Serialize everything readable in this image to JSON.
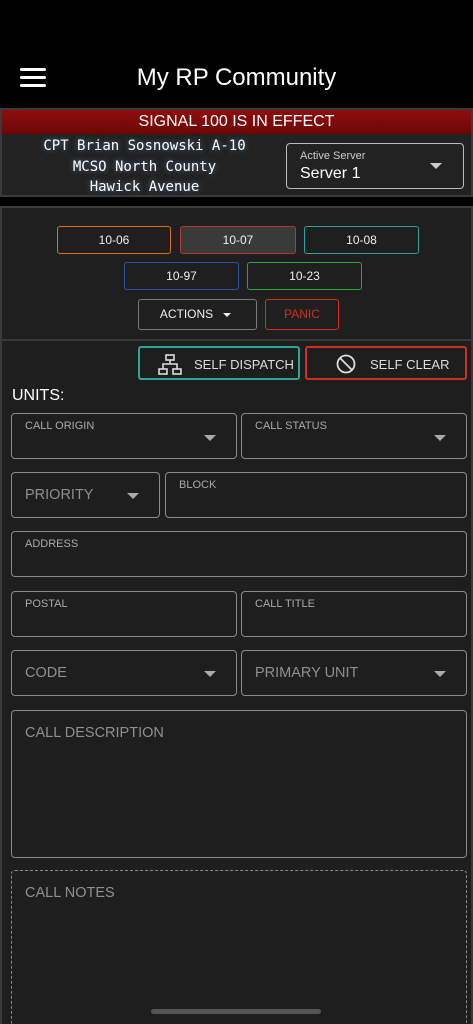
{
  "header": {
    "title": "My RP Community",
    "menu_icon": "hamburger-menu-icon"
  },
  "info": {
    "signal_banner": "SIGNAL 100 IS IN EFFECT",
    "officer_line1": "CPT Brian Sosnowski A-10",
    "officer_line2": "MCSO North County",
    "officer_line3": "Hawick Avenue",
    "server_label": "Active Server",
    "server_value": "Server 1"
  },
  "status_buttons": [
    {
      "label": "10-06",
      "color": "#e06a1a"
    },
    {
      "label": "10-07",
      "color": "#b23a3a"
    },
    {
      "label": "10-08",
      "color": "#2fa39a"
    },
    {
      "label": "10-97",
      "color": "#2c4fa8"
    },
    {
      "label": "10-23",
      "color": "#2ea23b"
    }
  ],
  "actions": {
    "actions_label": "ACTIONS",
    "panic_label": "PANIC",
    "panic_color": "#d0301f"
  },
  "dispatch": {
    "self_dispatch_label": "SELF DISPATCH",
    "self_dispatch_icon": "network-icon",
    "self_dispatch_color": "#2fa39a",
    "self_clear_label": "SELF CLEAR",
    "self_clear_icon": "no-entry-icon",
    "self_clear_color": "#d0301f"
  },
  "form": {
    "units_label": "UNITS:",
    "call_origin": "CALL ORIGIN",
    "call_status": "CALL STATUS",
    "priority": "PRIORITY",
    "block": "BLOCK",
    "address": "ADDRESS",
    "postal": "POSTAL",
    "call_title": "CALL TITLE",
    "code": "CODE",
    "primary_unit": "PRIMARY UNIT",
    "call_description": "CALL DESCRIPTION",
    "call_notes": "CALL NOTES"
  },
  "colors": {
    "background": "#000000",
    "panel": "#1e1e1e",
    "banner": "#8e0d0d"
  }
}
